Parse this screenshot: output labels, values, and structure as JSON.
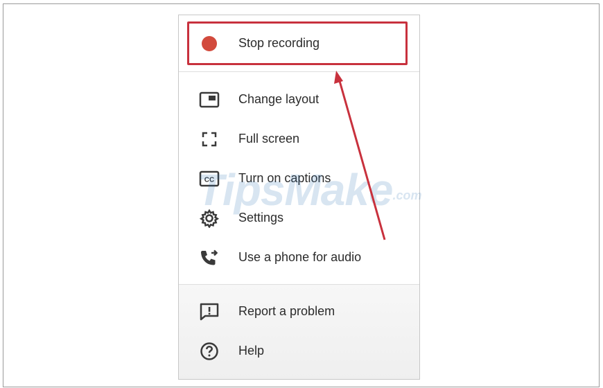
{
  "menu": {
    "stop_recording": "Stop recording",
    "items": [
      {
        "label": "Change layout",
        "icon": "change-layout-icon"
      },
      {
        "label": "Full screen",
        "icon": "full-screen-icon"
      },
      {
        "label": "Turn on captions",
        "icon": "captions-icon"
      },
      {
        "label": "Settings",
        "icon": "gear-icon"
      },
      {
        "label": "Use a phone for audio",
        "icon": "phone-audio-icon"
      }
    ],
    "bottom_items": [
      {
        "label": "Report a problem",
        "icon": "report-problem-icon"
      },
      {
        "label": "Help",
        "icon": "help-icon"
      }
    ]
  },
  "watermark": {
    "main": "TipsMake",
    "suffix": ".com"
  },
  "colors": {
    "record": "#d24a3d",
    "annotation": "#c8313d",
    "icon": "#3a3a3a"
  }
}
